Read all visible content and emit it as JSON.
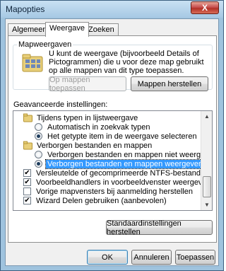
{
  "window": {
    "title": "Mapopties",
    "close_glyph": "X"
  },
  "tabs": [
    {
      "label": "Algemeen",
      "active": false
    },
    {
      "label": "Weergave",
      "active": true
    },
    {
      "label": "Zoeken",
      "active": false
    }
  ],
  "folder_views": {
    "group_label": "Mapweergaven",
    "description": "U kunt de weergave (bijvoorbeeld Details of Pictogrammen) die u voor deze map gebruikt op alle mappen van dit type toepassen.",
    "apply_button": "Op mappen toepassen",
    "reset_button": "Mappen herstellen"
  },
  "advanced": {
    "label": "Geavanceerde instellingen:",
    "items": [
      {
        "type": "folder",
        "label": "Tijdens typen in lijstweergave"
      },
      {
        "type": "radio",
        "checked": false,
        "label": "Automatisch in zoekvak typen"
      },
      {
        "type": "radio",
        "checked": true,
        "label": "Het getypte item in de weergave selecteren"
      },
      {
        "type": "folder",
        "label": "Verborgen bestanden en mappen"
      },
      {
        "type": "radio",
        "checked": false,
        "label": "Verborgen bestanden en mappen niet weergeven"
      },
      {
        "type": "radio",
        "checked": true,
        "label": "Verborgen bestanden en mappen weergeven",
        "selected": true
      },
      {
        "type": "check",
        "checked": true,
        "label": "Versleutelde of gecomprimeerde NTFS-bestanden in een"
      },
      {
        "type": "check",
        "checked": true,
        "label": "Voorbeeldhandlers in voorbeeldvenster weergeven"
      },
      {
        "type": "check",
        "checked": false,
        "label": "Vorige mapvensters bij aanmelding herstellen"
      },
      {
        "type": "check",
        "checked": true,
        "label": "Wizard Delen gebruiken (aanbevolen)"
      }
    ],
    "restore_defaults_button": "Standaardinstellingen herstellen"
  },
  "dialog_buttons": {
    "ok": "OK",
    "cancel": "Annuleren",
    "apply": "Toepassen"
  },
  "colors": {
    "selection": "#3399ff",
    "titlebar": "#a6c9e4",
    "close": "#c75050"
  }
}
